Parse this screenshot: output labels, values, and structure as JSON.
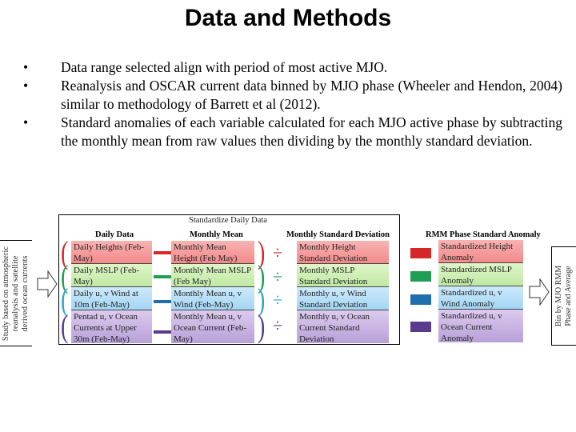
{
  "title": "Data and Methods",
  "bullets": [
    "Data range selected align with period of most active MJO.",
    "Reanalysis and OSCAR current data binned by MJO phase (Wheeler and Hendon, 2004) similar to methodology of Barrett et al (2012).",
    "Standard anomalies of each variable calculated for each MJO active phase by subtracting the monthly mean from raw values then dividing by the monthly standard deviation."
  ],
  "bullet_symbol": "•",
  "diagram": {
    "left_note": "Study based on atmospheric reanalysis and satellite derived ocean currents",
    "box_title": "Standardize Daily Data",
    "columns": {
      "daily": "Daily Data",
      "mean": "Monthly Mean",
      "std": "Monthly Standard Deviation",
      "anomaly": "RMM Phase Standard Anomaly"
    },
    "rows": [
      {
        "color": "#d62728",
        "daily": "Daily Heights (Feb-May)",
        "mean": "Monthly Mean Height (Feb May)",
        "std": "Monthly Height Standard Deviation",
        "anomaly": "Standardized Height Anomaly"
      },
      {
        "color": "#1f9e55",
        "daily": "Daily MSLP (Feb-May)",
        "mean": "Monthly Mean MSLP (Feb May)",
        "std": "Monthly MSLP Standard Deviation",
        "anomaly": "Standardized MSLP Anomaly"
      },
      {
        "color": "#1f6fae",
        "daily": "Daily u, v Wind at 10m (Feb-May)",
        "mean": "Monthly Mean u, v Wind (Feb-May)",
        "std": "Monthly u, v Wind Standard Deviation",
        "anomaly": "Standardized u, v Wind Anomaly"
      },
      {
        "color": "#5b3a8e",
        "daily": "Pentad u, v Ocean Currents at Upper 30m (Feb-May)",
        "mean": "Monthly Mean u, v Ocean Current (Feb-May)",
        "std": "Monthly u, v Ocean Current Standard Deviation",
        "anomaly": "Standardized u, v Ocean Current Anomaly"
      }
    ],
    "paren_colors": [
      "#d62728",
      "#1f9e55",
      "#2aa7c9",
      "#5b3a8e"
    ],
    "div_colors": [
      "#d62728",
      "#1f9e55",
      "#2aa7c9",
      "#5b3a8e"
    ],
    "symbols": {
      "open_paren": "(",
      "close_paren": ")",
      "divide": "÷"
    },
    "right_note": "Bin by MJO RMM Phase and Average"
  }
}
